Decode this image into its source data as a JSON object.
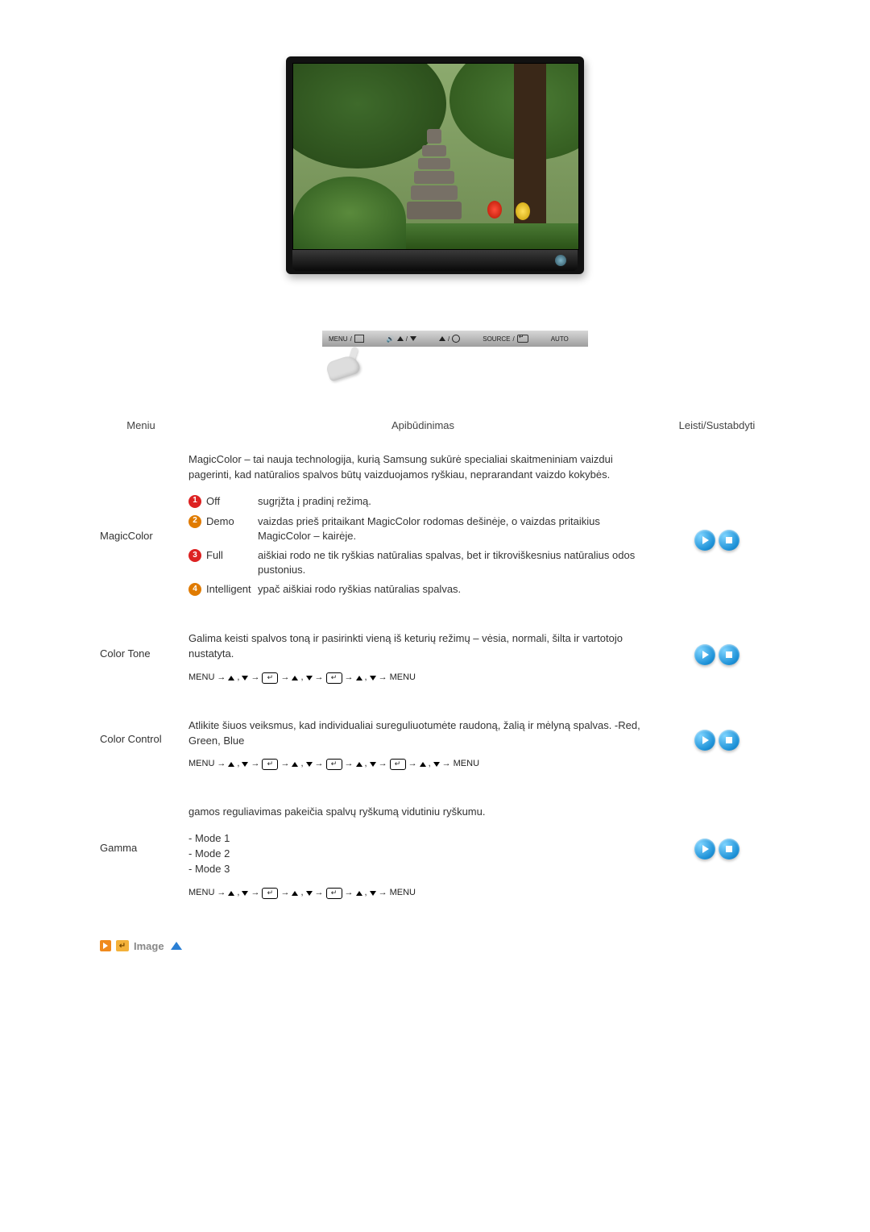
{
  "controlBar": {
    "menu": "MENU",
    "source": "SOURCE",
    "auto": "AUTO"
  },
  "headers": {
    "menu": "Meniu",
    "desc": "Apibūdinimas",
    "play": "Leisti/Sustabdyti"
  },
  "magicColor": {
    "label": "MagicColor",
    "intro": "MagicColor – tai nauja technologija, kurią Samsung sukūrė specialiai skaitmeniniam vaizdui pagerinti, kad natūralios spalvos būtų vaizduojamos ryškiau, neprarandant vaizdo kokybės.",
    "opts": {
      "off": {
        "name": "Off",
        "text": "sugrįžta į pradinį režimą."
      },
      "demo": {
        "name": "Demo",
        "text": "vaizdas prieš pritaikant MagicColor rodomas dešinėje, o vaizdas pritaikius MagicColor – kairėje."
      },
      "full": {
        "name": "Full",
        "text": "aiškiai rodo ne tik ryškias natūralias spalvas, bet ir tikroviškesnius natūralius odos pustonius."
      },
      "intelligent": {
        "name": "Intelligent",
        "text": "ypač aiškiai rodo ryškias natūralias spalvas."
      }
    }
  },
  "colorTone": {
    "label": "Color Tone",
    "text": "Galima keisti spalvos toną ir pasirinkti vieną iš keturių režimų – vėsia, normali, šilta ir vartotojo nustatyta.",
    "pathStart": "MENU",
    "pathEnd": "MENU"
  },
  "colorControl": {
    "label": "Color Control",
    "text": "Atlikite šiuos veiksmus, kad individualiai sureguliuotumėte raudoną, žalią ir mėlyną spalvas. -Red, Green, Blue",
    "pathStart": "MENU",
    "pathEnd": "MENU"
  },
  "gamma": {
    "label": "Gamma",
    "intro": "gamos reguliavimas pakeičia spalvų ryškumą vidutiniu ryškumu.",
    "modes": [
      "- Mode 1",
      "- Mode 2",
      "- Mode 3"
    ],
    "pathStart": "MENU",
    "pathEnd": "MENU"
  },
  "footer": {
    "title": "Image"
  }
}
